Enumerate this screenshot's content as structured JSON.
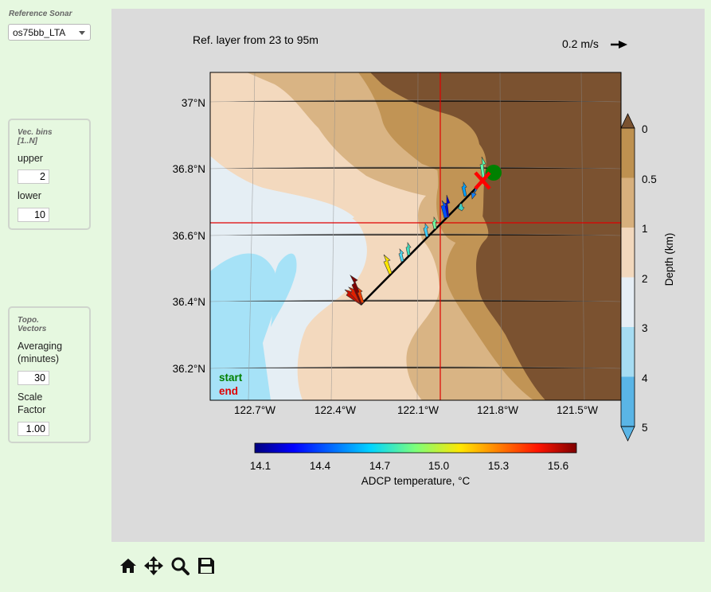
{
  "sidebar": {
    "reference_label": "Reference Sonar",
    "sonar_selected": "os75bb_LTA",
    "vec_bins": {
      "title": "Vec. bins\n[1..N]",
      "upper_label": "upper",
      "upper_value": "2",
      "lower_label": "lower",
      "lower_value": "10"
    },
    "topo": {
      "title": "Topo.\nVectors",
      "averaging_label": "Averaging\n(minutes)",
      "averaging_value": "30",
      "scale_label": "Scale\nFactor",
      "scale_value": "1.00"
    }
  },
  "plot": {
    "ref_layer_text": "Ref. layer from 23 to 95m",
    "scale_text": "0.2 m/s",
    "lat_ticks": [
      "37°N",
      "36.8°N",
      "36.6°N",
      "36.4°N",
      "36.2°N"
    ],
    "lon_ticks": [
      "122.7°W",
      "122.4°W",
      "122.1°W",
      "121.8°W",
      "121.5°W"
    ],
    "start_label": "start",
    "end_label": "end",
    "depth_colorbar": {
      "label": "Depth (km)",
      "ticks": [
        "0",
        "0.5",
        "1",
        "2",
        "3",
        "4",
        "5"
      ],
      "colors": [
        "#7a5230",
        "#be9150",
        "#d7b07d",
        "#f2d8bd",
        "#e6eef5",
        "#a6dcf2",
        "#5ab5e6"
      ]
    },
    "temp_colorbar": {
      "label": "ADCP temperature, °C",
      "ticks": [
        "14.1",
        "14.4",
        "14.7",
        "15.0",
        "15.3",
        "15.6"
      ]
    },
    "colors": {
      "start": "#008000",
      "end": "#e00000",
      "crosshair": "#e00000"
    }
  },
  "toolbar": {
    "icons": [
      "home-icon",
      "pan-icon",
      "zoom-icon",
      "save-icon"
    ]
  }
}
